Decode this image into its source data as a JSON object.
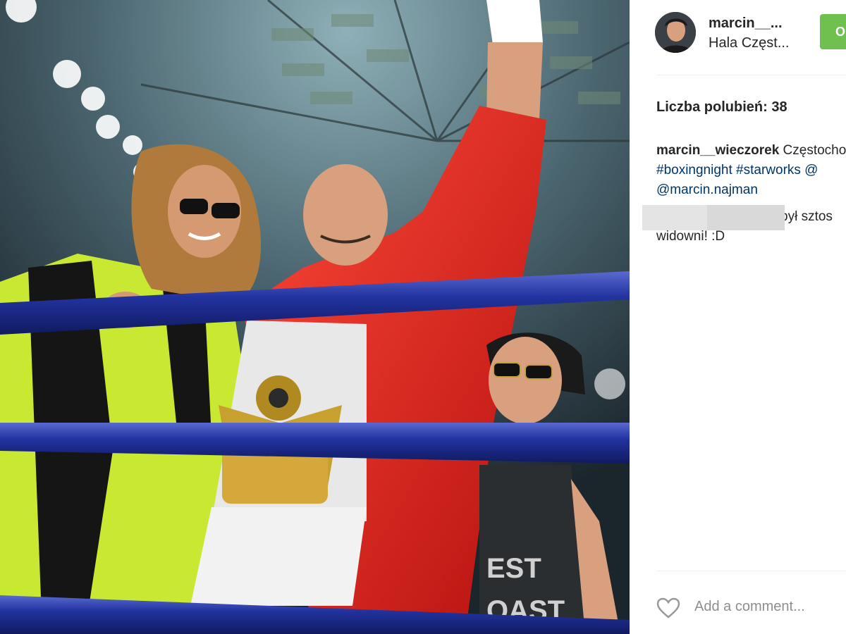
{
  "post": {
    "username_short": "marcin__...",
    "location": "Hala Częst...",
    "follow_label": "Obserwuj",
    "likes_text": "Liczba polubień: 38",
    "caption": {
      "username": "marcin__wieczorek",
      "text_start": "Częstochowa",
      "hashtag_line": "#boxingnight #starworks @",
      "mention_line": "@marcin.najman"
    },
    "comment": {
      "line1": "był sztos",
      "line2": "widowni! :D"
    },
    "comment_placeholder": "Add a comment..."
  },
  "icons": {
    "like": "heart-icon",
    "profile": "avatar"
  },
  "colors": {
    "follow_button": "#70c050",
    "text": "#262626",
    "placeholder": "#8e8e8e",
    "hashtag": "#003569"
  }
}
